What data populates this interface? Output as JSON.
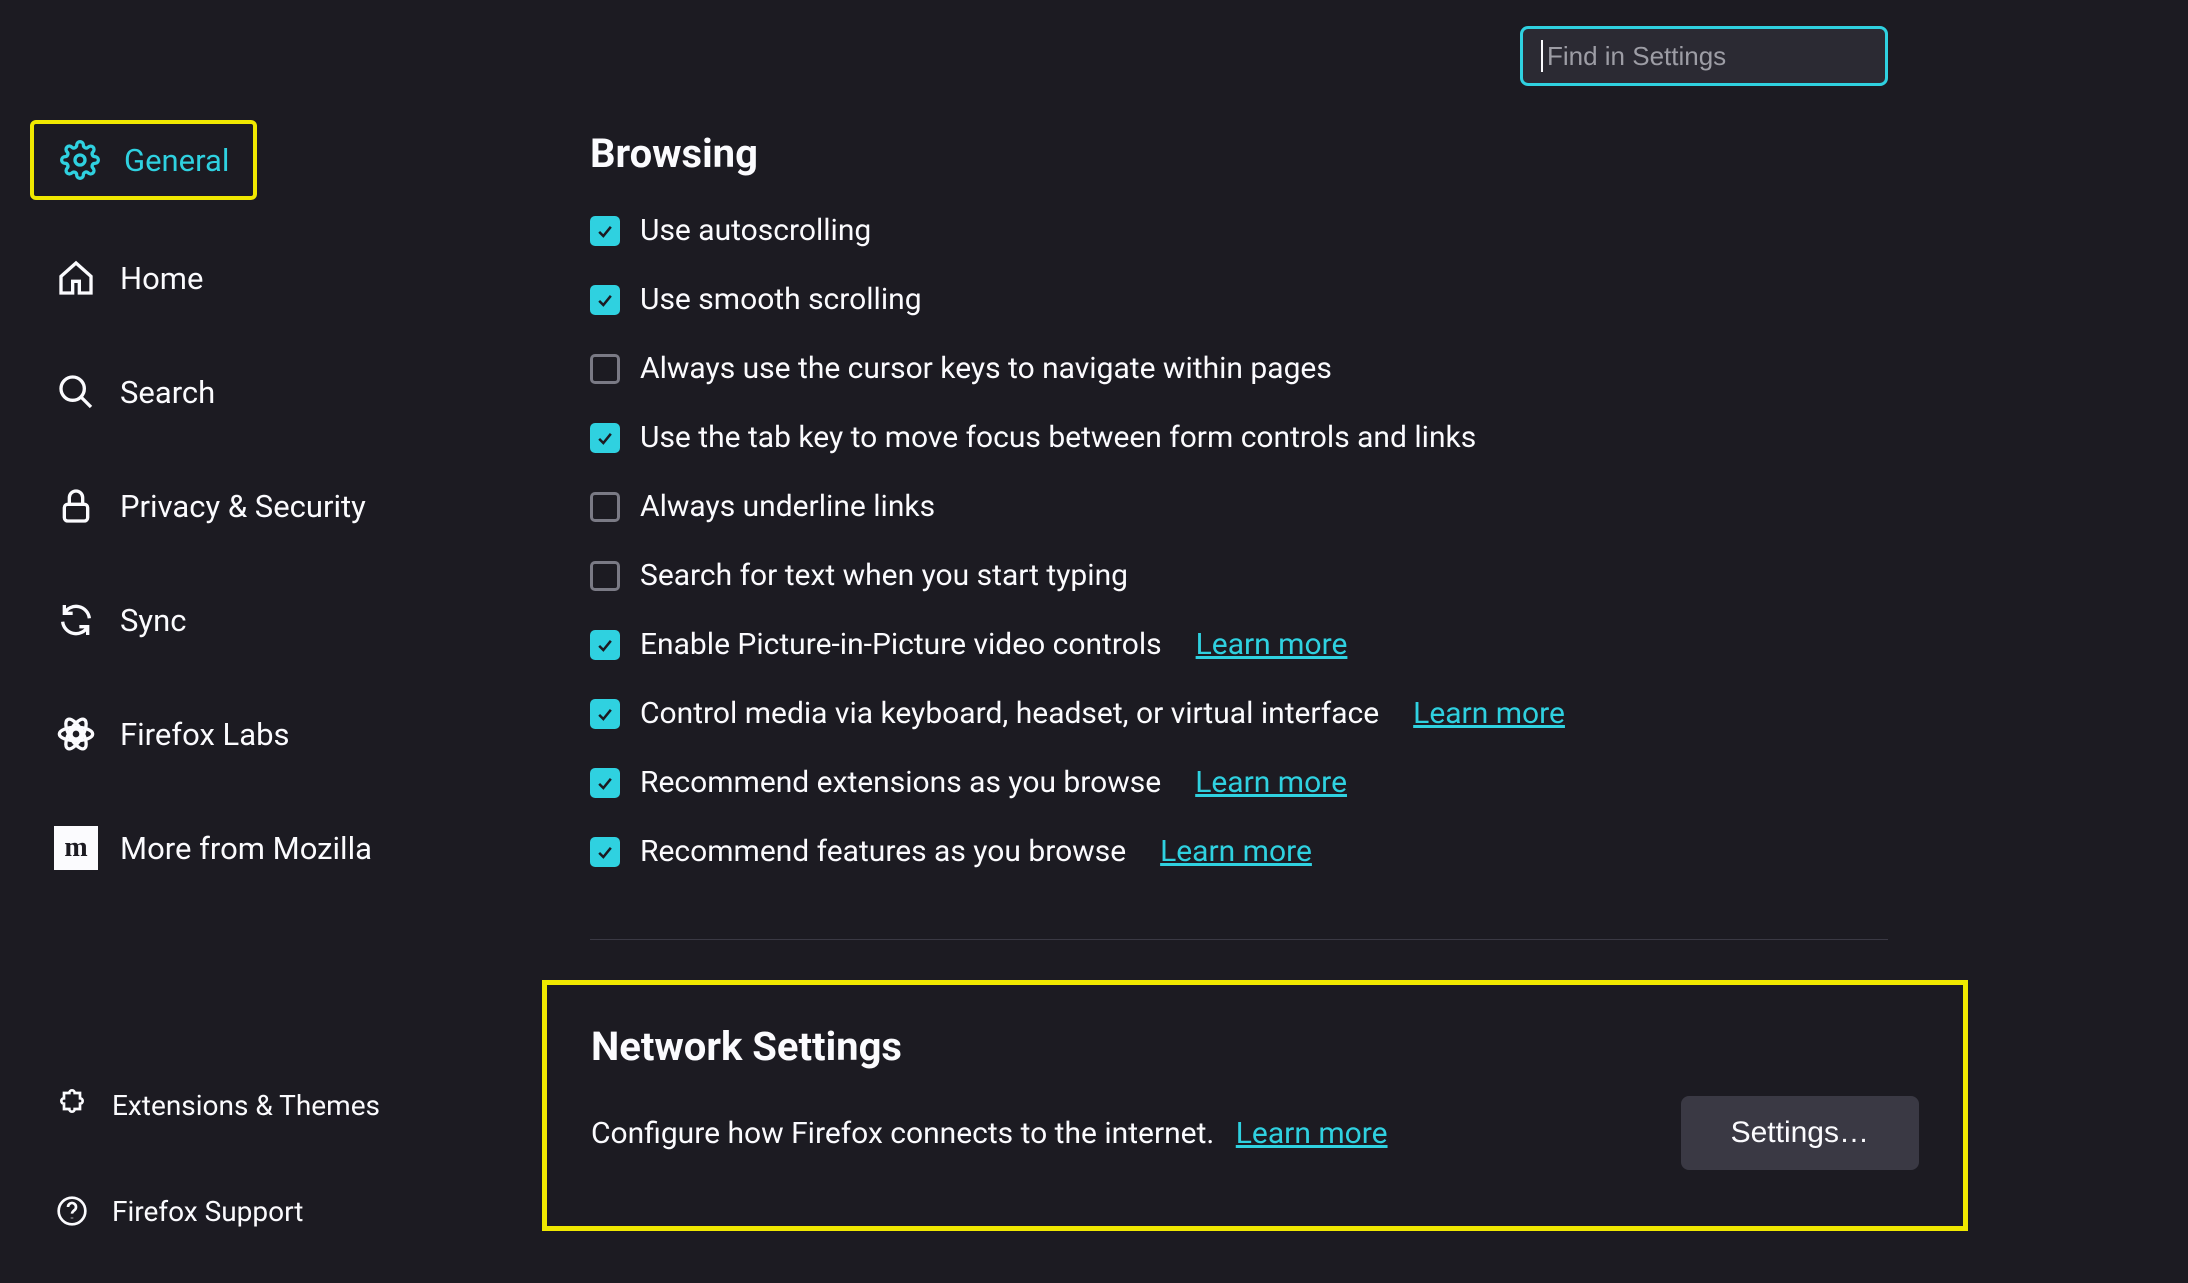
{
  "search": {
    "placeholder": "Find in Settings",
    "value": ""
  },
  "sidebar": {
    "items": [
      {
        "label": "General",
        "icon": "gear-icon"
      },
      {
        "label": "Home",
        "icon": "home-icon"
      },
      {
        "label": "Search",
        "icon": "search-icon"
      },
      {
        "label": "Privacy & Security",
        "icon": "lock-icon"
      },
      {
        "label": "Sync",
        "icon": "sync-icon"
      },
      {
        "label": "Firefox Labs",
        "icon": "labs-icon"
      },
      {
        "label": "More from Mozilla",
        "icon": "mozilla-icon"
      }
    ],
    "bottom": [
      {
        "label": "Extensions & Themes",
        "icon": "puzzle-icon"
      },
      {
        "label": "Firefox Support",
        "icon": "help-icon"
      }
    ]
  },
  "browsing": {
    "title": "Browsing",
    "options": [
      {
        "label": "Use autoscrolling",
        "checked": true
      },
      {
        "label": "Use smooth scrolling",
        "checked": true
      },
      {
        "label": "Always use the cursor keys to navigate within pages",
        "checked": false
      },
      {
        "label": "Use the tab key to move focus between form controls and links",
        "checked": true
      },
      {
        "label": "Always underline links",
        "checked": false
      },
      {
        "label": "Search for text when you start typing",
        "checked": false
      },
      {
        "label": "Enable Picture-in-Picture video controls",
        "checked": true,
        "learn_more": "Learn more"
      },
      {
        "label": "Control media via keyboard, headset, or virtual interface",
        "checked": true,
        "learn_more": "Learn more"
      },
      {
        "label": "Recommend extensions as you browse",
        "checked": true,
        "learn_more": "Learn more"
      },
      {
        "label": "Recommend features as you browse",
        "checked": true,
        "learn_more": "Learn more"
      }
    ]
  },
  "network": {
    "title": "Network Settings",
    "description": "Configure how Firefox connects to the internet.",
    "learn_more": "Learn more",
    "button": "Settings…"
  },
  "colors": {
    "accent": "#2fd1e0",
    "highlight_border": "#f0e800",
    "bg": "#1c1b22",
    "text": "#fbfbfe"
  }
}
